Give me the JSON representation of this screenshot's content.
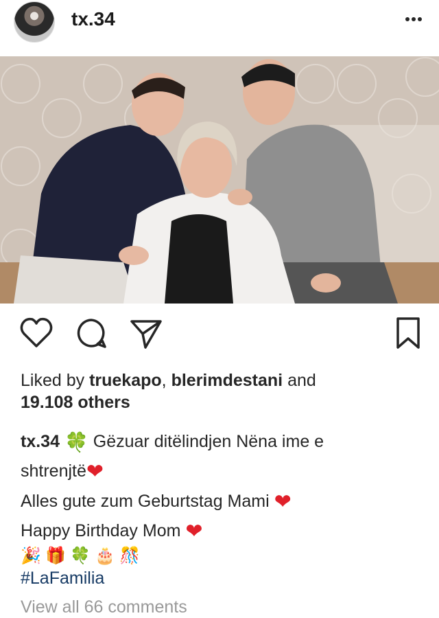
{
  "post": {
    "username": "tx.34",
    "more_icon": "more-horizontal-icon"
  },
  "actions": {
    "like_icon": "heart-icon",
    "comment_icon": "comment-icon",
    "share_icon": "send-icon",
    "save_icon": "bookmark-icon"
  },
  "likes": {
    "prefix": "Liked by",
    "user1": "truekapo",
    "sep": ",",
    "user2": "blerimdestani",
    "and": "and",
    "others": "19.108 others"
  },
  "caption": {
    "username": "tx.34",
    "clover": "🍀",
    "line1": "Gëzuar ditëlindjen Nëna ime e",
    "line2": "shtrenjtë",
    "line3": "Alles gute zum Geburtstag Mami",
    "line4": "Happy Birthday Mom",
    "heart": "❤",
    "emojis": [
      "🎉",
      "🎁",
      "🍀",
      "🎂",
      "🎊"
    ],
    "hashtag": "#LaFamilia"
  },
  "comments": {
    "view_all": "View all 66 comments"
  },
  "colors": {
    "heart": "#e0202a",
    "hashtag": "#163a64",
    "muted": "#999999"
  }
}
